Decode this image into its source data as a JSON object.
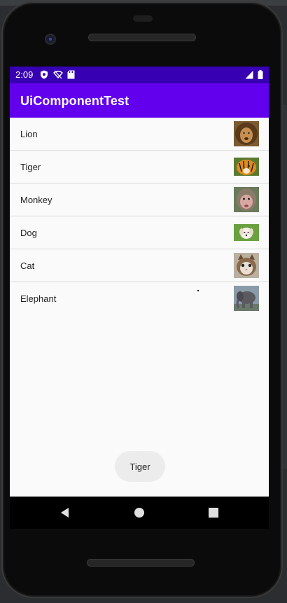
{
  "status_bar": {
    "time": "2:09",
    "icons": [
      "shield-icon",
      "wifi-off-icon",
      "sd-card-icon",
      "cell-signal-icon",
      "battery-icon"
    ]
  },
  "app_bar": {
    "title": "UiComponentTest",
    "color": "#6200ee",
    "status_color": "#3700b3"
  },
  "list": {
    "items": [
      {
        "label": "Lion",
        "image": "lion-image"
      },
      {
        "label": "Tiger",
        "image": "tiger-image"
      },
      {
        "label": "Monkey",
        "image": "monkey-image"
      },
      {
        "label": "Dog",
        "image": "dog-image"
      },
      {
        "label": "Cat",
        "image": "cat-image"
      },
      {
        "label": "Elephant",
        "image": "elephant-image"
      }
    ]
  },
  "toast": {
    "text": "Tiger"
  },
  "nav_bar": {
    "icons": [
      "back-icon",
      "home-icon",
      "recents-icon"
    ]
  }
}
